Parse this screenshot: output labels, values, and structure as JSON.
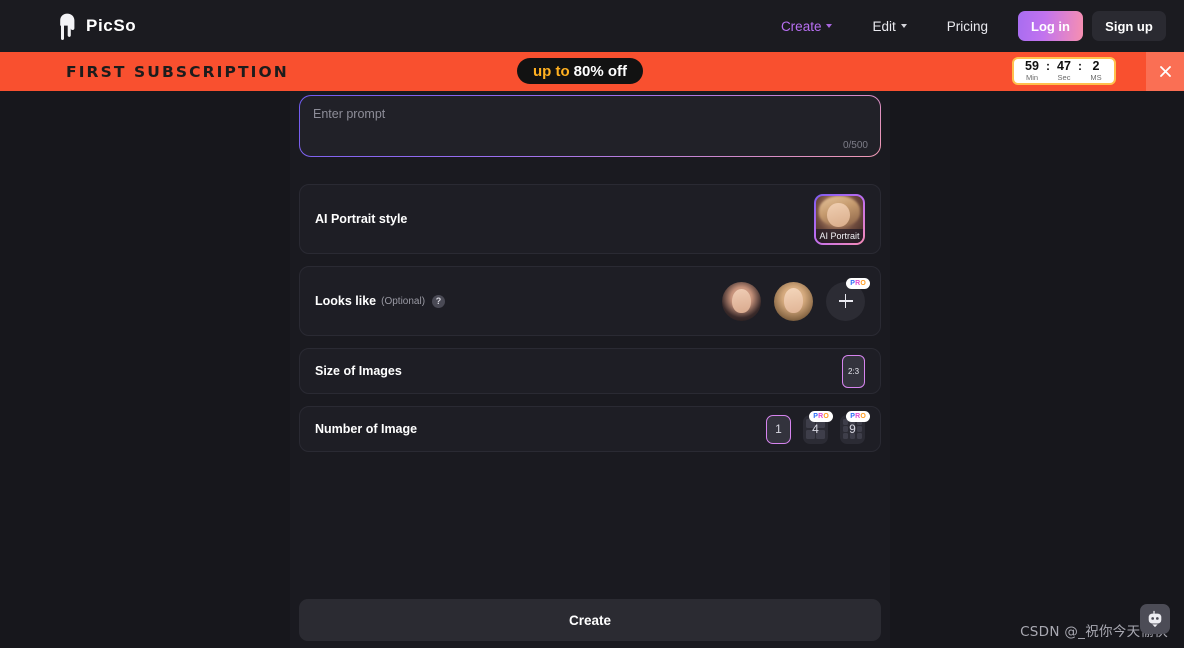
{
  "header": {
    "brand": "PicSo",
    "brand_icon": "picso-drip-logo-icon",
    "nav": [
      {
        "label": "Create",
        "has_caret": true,
        "accent": true
      },
      {
        "label": "Edit",
        "has_caret": true,
        "accent": false
      },
      {
        "label": "Pricing",
        "has_caret": false,
        "accent": false
      }
    ],
    "login_label": "Log in",
    "signup_label": "Sign up",
    "accent_color": "#b86ff2",
    "login_gradient": "#a86df0 → #f78fb0"
  },
  "promo": {
    "title": "FIRST SUBSCRIPTION",
    "offer_prefix": "up to",
    "offer_value": "80% off",
    "background": "#f9502f",
    "timer": {
      "minutes": "59",
      "seconds": "47",
      "ms": "2",
      "minutes_label": "Min",
      "seconds_label": "Sec",
      "ms_label": "MS",
      "separator": ":"
    },
    "close_icon": "close-icon"
  },
  "prompt": {
    "placeholder": "Enter prompt",
    "value": "",
    "counter": "0/500"
  },
  "style_section": {
    "label": "AI Portrait style",
    "selected": {
      "caption": "AI Portrait",
      "selected": true
    }
  },
  "looks_like": {
    "label": "Looks like",
    "optional": "(Optional)",
    "help_icon": "question-mark-icon",
    "avatars": [
      {
        "name": "avatar-option-1"
      },
      {
        "name": "avatar-option-2"
      }
    ],
    "add_button": {
      "icon": "plus-icon",
      "badge": "PRO",
      "badge_letters": [
        "P",
        "R",
        "O"
      ]
    }
  },
  "size_section": {
    "label": "Size of Images",
    "options": [
      {
        "value": "2:3",
        "selected": true
      }
    ]
  },
  "number_section": {
    "label": "Number of Image",
    "options": [
      {
        "value": "1",
        "selected": true,
        "pro": false,
        "grid": 1
      },
      {
        "value": "4",
        "selected": false,
        "pro": true,
        "grid": 4,
        "badge": "PRO"
      },
      {
        "value": "9",
        "selected": false,
        "pro": true,
        "grid": 9,
        "badge": "PRO"
      }
    ]
  },
  "footer": {
    "create_label": "Create"
  },
  "overlay": {
    "watermark": "CSDN @_祝你今天愉快",
    "chat_icon": "chat-bot-icon"
  }
}
